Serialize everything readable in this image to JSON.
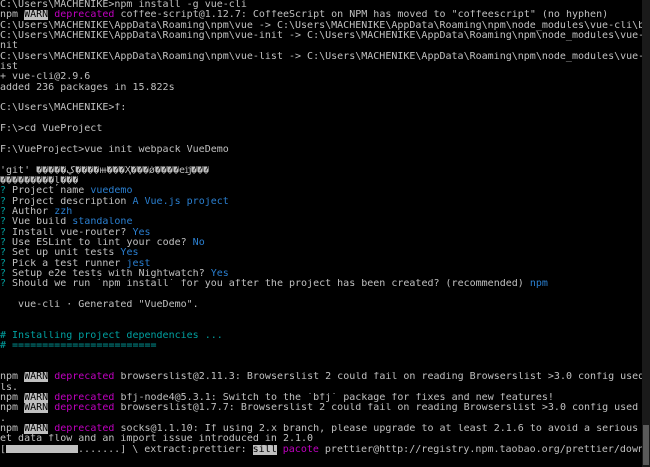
{
  "terminal": {
    "lines": {
      "l1": "C:\\Users\\MACHENIKE>npm install -g vue-cli",
      "l2_npm": "npm ",
      "l2_warn": "WARN",
      "l2_dep": " deprecated",
      "l2_rest": " coffee-script@1.12.7: CoffeeScript on NPM has moved to \"coffeescript\" (no hyphen)",
      "l3": "C:\\Users\\MACHENIKE\\AppData\\Roaming\\npm\\vue -> C:\\Users\\MACHENIKE\\AppData\\Roaming\\npm\\node_modules\\vue-cli\\bin\\vue",
      "l4": "C:\\Users\\MACHENIKE\\AppData\\Roaming\\npm\\vue-init -> C:\\Users\\MACHENIKE\\AppData\\Roaming\\npm\\node_modules\\vue-cli\\bin\\vue-i",
      "l5": "nit",
      "l6": "C:\\Users\\MACHENIKE\\AppData\\Roaming\\npm\\vue-list -> C:\\Users\\MACHENIKE\\AppData\\Roaming\\npm\\node_modules\\vue-cli\\bin\\vue-l",
      "l7": "ist",
      "l8": "+ vue-cli@2.9.6",
      "l9": "added 236 packages in 15.822s",
      "l10": "",
      "l11": "C:\\Users\\MACHENIKE>f:",
      "l12": "",
      "l13": "F:\\>cd VueProject",
      "l14": "",
      "l15": "F:\\VueProject>vue init webpack VueDemo",
      "l16": "",
      "l17": "'git' �����ڲ����ⲿ���Ҳ���ǿ����еĳ���",
      "l18": "���������ļ���",
      "q_name_mark": "?",
      "q_name": " Project name ",
      "a_name": "vuedemo",
      "q_desc_mark": "?",
      "q_desc": " Project description ",
      "a_desc": "A Vue.js project",
      "q_author_mark": "?",
      "q_author": " Author ",
      "a_author": "zzh",
      "q_build_mark": "?",
      "q_build": " Vue build ",
      "a_build": "standalone",
      "q_router_mark": "?",
      "q_router": " Install vue-router? ",
      "a_router": "Yes",
      "q_eslint_mark": "?",
      "q_eslint": " Use ESLint to lint your code? ",
      "a_eslint": "No",
      "q_unit_mark": "?",
      "q_unit": " Set up unit tests ",
      "a_unit": "Yes",
      "q_runner_mark": "?",
      "q_runner": " Pick a test runner ",
      "a_runner": "jest",
      "q_e2e_mark": "?",
      "q_e2e": " Setup e2e tests with Nightwatch? ",
      "a_e2e": "Yes",
      "q_npm_mark": "?",
      "q_npm": " Should we run `npm install` for you after the project has been created? (recommended) ",
      "a_npm": "npm",
      "blank1": "",
      "generated": "   vue-cli · Generated \"VueDemo\".",
      "blank2": "",
      "blank3": "",
      "install_hdr": "# Installing project dependencies ...",
      "sep_hdr": "# ========================",
      "blank4": "",
      "blank5": "",
      "w1_npm": "npm ",
      "w1_warn": "WARN",
      "w1_dep": " deprecated",
      "w1_rest": " browserslist@2.11.3: Browserslist 2 could fail on reading Browserslist >3.0 config used in other too",
      "w1_cont": "ls.",
      "w2_npm": "npm ",
      "w2_warn": "WARN",
      "w2_dep": " deprecated",
      "w2_rest": " bfj-node4@5.3.1: Switch to the `bfj` package for fixes and new features!",
      "w3_npm": "npm ",
      "w3_warn": "WARN",
      "w3_dep": " deprecated",
      "w3_rest": " browserslist@1.7.7: Browserslist 2 could fail on reading Browserslist >3.0 config used in other tools",
      "w3_cont": ".",
      "w4_npm": "npm ",
      "w4_warn": "WARN",
      "w4_dep": " deprecated",
      "w4_rest": " socks@1.1.10: If using 2.x branch, please upgrade to at least 2.1.6 to avoid a serious bug with sock",
      "w4_cont": "et data flow and an import issue introduced in 2.1.0",
      "p_open": "[",
      "p_after": ".......] \\ extract:prettier: ",
      "p_sill": "sill",
      "p_pacote": " pacote",
      "p_rest": " prettier@http://registry.npm.taobao.org/prettier/download/prettier"
    },
    "colors": {
      "background": "#000000",
      "text": "#c0c0c0",
      "deprecated": "#c000c0",
      "prompt_mark": "#00a0a0",
      "answer": "#2a7fd0"
    }
  }
}
